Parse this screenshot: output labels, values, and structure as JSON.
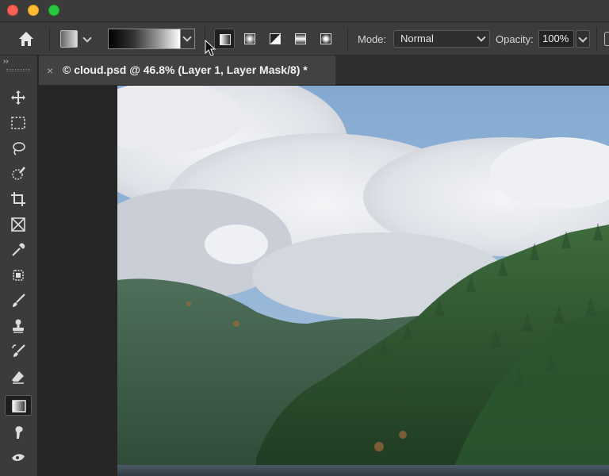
{
  "window": {
    "controls": [
      "close",
      "minimize",
      "maximize"
    ]
  },
  "options_bar": {
    "home_icon": "home-icon",
    "tool_preset_icon": "gradient-tool-preset-icon",
    "gradient_preview": "black-to-white",
    "gradient_types": [
      "linear",
      "radial",
      "angle",
      "reflected",
      "diamond"
    ],
    "active_gradient_type": "linear",
    "mode_label": "Mode:",
    "mode_value": "Normal",
    "opacity_label": "Opacity:",
    "opacity_value": "100%"
  },
  "toolbar": {
    "collapse_label": "››",
    "tools": [
      {
        "name": "move-tool",
        "icon": "move-icon"
      },
      {
        "name": "marquee-tool",
        "icon": "marquee-icon"
      },
      {
        "name": "lasso-tool",
        "icon": "lasso-icon"
      },
      {
        "name": "quick-selection-tool",
        "icon": "quick-selection-icon"
      },
      {
        "name": "crop-tool",
        "icon": "crop-icon"
      },
      {
        "name": "frame-tool",
        "icon": "frame-icon"
      },
      {
        "name": "eyedropper-tool",
        "icon": "eyedropper-icon"
      },
      {
        "name": "spot-healing-tool",
        "icon": "bandage-icon"
      },
      {
        "name": "brush-tool",
        "icon": "brush-icon"
      },
      {
        "name": "clone-stamp-tool",
        "icon": "stamp-icon"
      },
      {
        "name": "history-brush-tool",
        "icon": "history-brush-icon"
      },
      {
        "name": "eraser-tool",
        "icon": "eraser-icon"
      },
      {
        "name": "gradient-tool",
        "icon": "gradient-icon"
      },
      {
        "name": "smudge-tool",
        "icon": "smudge-icon"
      },
      {
        "name": "dodge-tool",
        "icon": "dodge-icon"
      }
    ],
    "active_tool": "gradient-tool"
  },
  "document": {
    "tab_close": "×",
    "tab_title": "© cloud.psd @ 46.8% (Layer 1, Layer Mask/8) *"
  },
  "canvas": {
    "image": "landscape-clouds-forest-lake"
  },
  "colors": {
    "panel": "#3c3c3c",
    "pasteboard": "#262626",
    "sky": "#8fb3d6"
  }
}
